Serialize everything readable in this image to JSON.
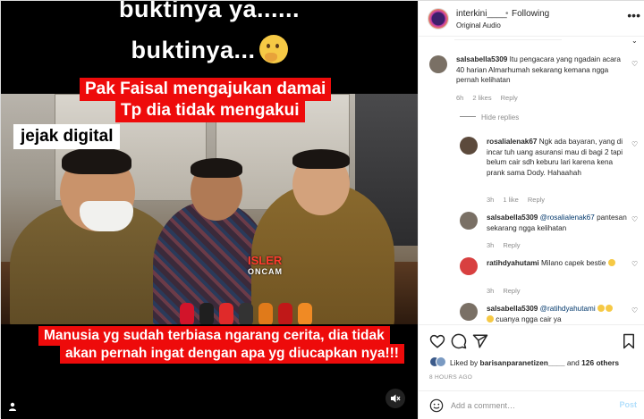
{
  "media": {
    "top_line1": "buktinya ya......",
    "top_line2": "buktinya...",
    "banner_line1": "Pak Faisal mengajukan damai",
    "banner_line2": "Tp dia tidak mengakui",
    "tag_label": "jejak digital",
    "watermark_top": "ISLER",
    "watermark_bottom": "ONCAM",
    "bottom_line1": "Manusia yg sudah terbiasa ngarang cerita, dia tidak",
    "bottom_line2": "akan pernah ingat dengan apa yg diucapkan nya!!!"
  },
  "header": {
    "username": "interkini____",
    "separator": "•",
    "follow_status": "Following",
    "audio_label": "Original Audio",
    "more_icon": "more-horizontal-icon"
  },
  "comments": [
    {
      "username": "salsabella5309",
      "text": "Itu pengacara yang ngadain acara 40 harian Almarhumah sekarang kemana ngga pernah kelihatan",
      "time": "6h",
      "likes": "2 likes",
      "reply": "Reply",
      "avatar_color": "#7a7065"
    },
    {
      "username": "rosalialenak67",
      "text": "Ngk ada bayaran, yang di incar tuh uang asuransi mau di bagi 2 tapi belum cair sdh keburu lari karena kena prank sama Dody. Hahaahah",
      "time": "3h",
      "likes": "1 like",
      "reply": "Reply",
      "avatar_color": "#5c4a3c"
    },
    {
      "username": "salsabella5309",
      "mention": "@rosalialenak67",
      "text": "pantesan sekarang ngga kelihatan",
      "time": "3h",
      "reply": "Reply",
      "avatar_color": "#7a7065"
    },
    {
      "username": "ratihdyahutami",
      "text": "Milano capek bestie",
      "time": "3h",
      "reply": "Reply",
      "avatar_color": "#d84040"
    },
    {
      "username": "salsabella5309",
      "mention": "@ratihdyahutami",
      "text": "cuanya ngga cair ya",
      "avatar_color": "#7a7065"
    }
  ],
  "hide_replies": "Hide replies",
  "likes_summary": {
    "prefix": "Liked by",
    "user": "barisanparanetizen____",
    "conjunction": "and",
    "others": "126 others"
  },
  "time_ago": "8 HOURS AGO",
  "add_comment": {
    "placeholder": "Add a comment…",
    "post_label": "Post"
  },
  "colors": {
    "banner_red": "#ee0b0b",
    "link_blue": "#00376b",
    "post_blue": "#b2dffc",
    "muted": "#8e8e8e"
  }
}
